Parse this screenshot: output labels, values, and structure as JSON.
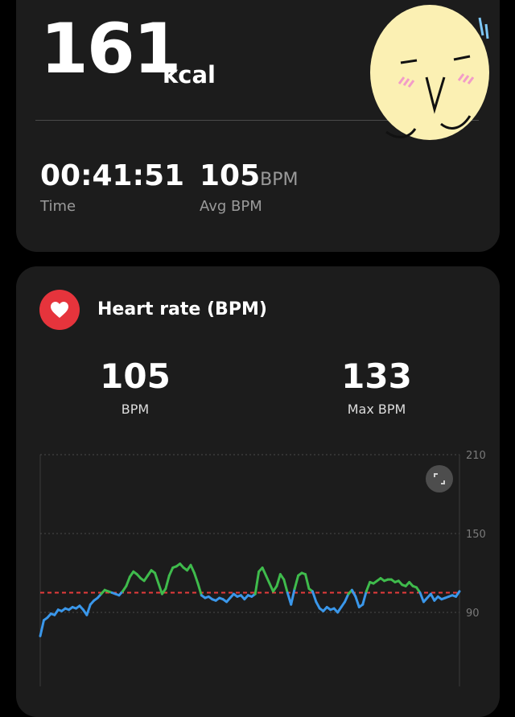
{
  "summary": {
    "calories_value": "161",
    "calories_unit": "kcal",
    "time_value": "00:41:51",
    "time_label": "Time",
    "avg_value": "105",
    "avg_unit": "BPM",
    "avg_label": "Avg BPM"
  },
  "heart": {
    "title": "Heart rate (BPM)",
    "avg_value": "105",
    "avg_label": "BPM",
    "max_value": "133",
    "max_label": "Max BPM",
    "icon": "heart-icon",
    "expand_icon": "expand-icon"
  },
  "colors": {
    "background": "#000000",
    "card": "#1c1c1c",
    "accent_red": "#e6343c",
    "line_blue": "#3a97ea",
    "line_green": "#3fbb4c",
    "avg_line": "#e63b3b"
  },
  "chart_data": {
    "type": "line",
    "yticks": [
      210,
      150,
      90
    ],
    "ylim": [
      70,
      210
    ],
    "average_line": 105,
    "zone_threshold": 105,
    "grid": true,
    "series": [
      {
        "values": [
          72,
          84,
          86,
          89,
          88,
          92,
          91,
          93,
          92,
          94,
          93,
          95,
          92,
          88,
          96,
          99,
          101,
          104,
          107,
          106,
          105,
          104,
          103,
          106,
          110,
          117,
          121,
          119,
          116,
          114,
          118,
          122,
          120,
          112,
          104,
          108,
          118,
          124,
          125,
          127,
          124,
          122,
          126,
          120,
          112,
          103,
          101,
          102,
          100,
          99,
          101,
          100,
          98,
          101,
          104,
          102,
          103,
          100,
          103,
          102,
          104,
          121,
          124,
          118,
          112,
          106,
          110,
          119,
          115,
          105,
          96,
          108,
          118,
          120,
          119,
          108,
          106,
          98,
          93,
          91,
          94,
          92,
          93,
          90,
          94,
          98,
          104,
          107,
          102,
          94,
          96,
          106,
          113,
          112,
          114,
          116,
          114,
          115,
          115,
          113,
          114,
          111,
          110,
          113,
          110,
          109,
          105,
          98,
          101,
          104,
          99,
          102,
          100,
          101,
          102,
          103,
          102,
          106
        ]
      }
    ]
  }
}
